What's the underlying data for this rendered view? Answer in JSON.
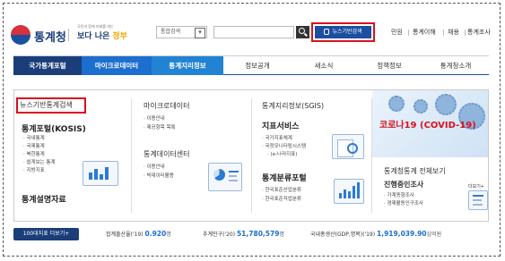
{
  "header": {
    "logo_text": "통계청",
    "slogan_small": "국민과 함께 미래를 여는",
    "slogan_main": "보다 나은",
    "slogan_accent": "정부",
    "search_select": "통합검색",
    "bigdata_button": "뉴스기반검색",
    "util_links": [
      "민원",
      "통계이해",
      "채용",
      "통계조사"
    ]
  },
  "gnb": [
    "국가통계포털",
    "마이크로데이터",
    "통계지리정보",
    "정보공개",
    "새소식",
    "정책정보",
    "통계청소개"
  ],
  "col1": {
    "highlight": "뉴스기반통계검색",
    "title": "통계포털(KOSIS)",
    "items": [
      "국내통계",
      "국제통계",
      "북한통계",
      "쉽게보는 통계",
      "지방지표"
    ],
    "footer": "통계설명자료"
  },
  "col2": {
    "title": "마이크로데이터",
    "items": [
      "이용안내",
      "제공항목 목록"
    ],
    "title2": "통계데이터센터",
    "items2": [
      "이용안내",
      "빅데이터활용"
    ]
  },
  "col3": {
    "title": "통계지리정보(SGIS)",
    "title2": "지표서비스",
    "items2": [
      "국가지표체계",
      "국정모니터링시스템",
      "(e-나라지표)"
    ],
    "title3": "통계분류포털",
    "items3": [
      "한국표준산업분류",
      "한국표준직업분류"
    ]
  },
  "col4": {
    "covid": "코로나19 (COVID-19)",
    "title": "통계청통계 전체보기",
    "subtitle": "진행중인조사",
    "items": [
      "가계동향조사",
      "경제활동인구조사"
    ],
    "more": "더보기+"
  },
  "bottom": {
    "more_button": "100대지표 더보기+",
    "stats": [
      {
        "label": "합계출산율('19)",
        "value": "0.920",
        "unit": "명"
      },
      {
        "label": "추계인구('20)",
        "value": "51,780,579",
        "unit": "명"
      },
      {
        "label": "국내총생산(GDP,명목)('19)",
        "value": "1,919,039.90",
        "unit": "십억원"
      }
    ]
  }
}
